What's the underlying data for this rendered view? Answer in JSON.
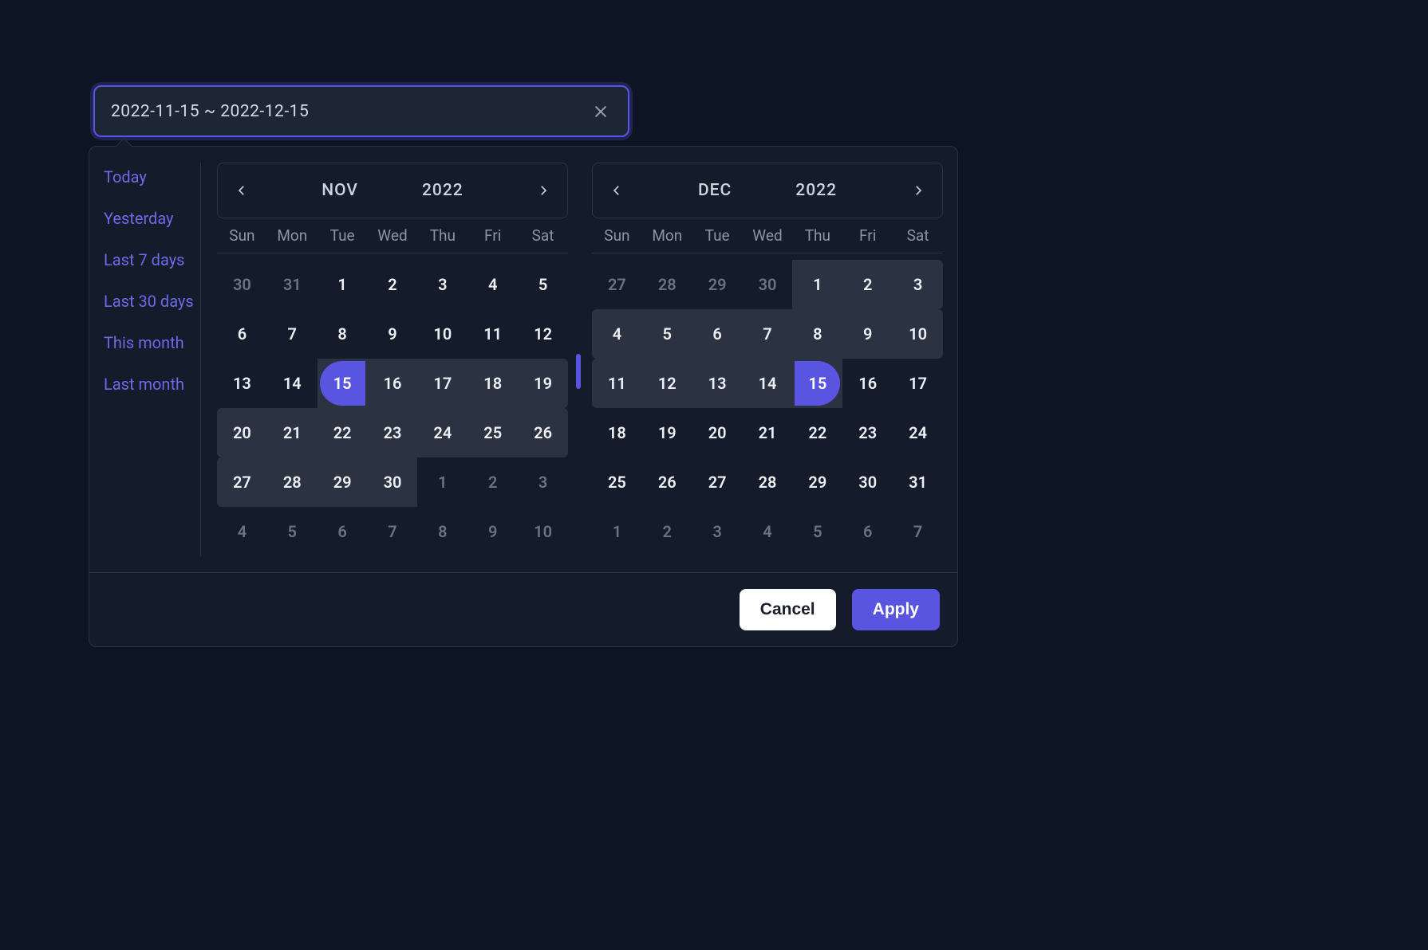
{
  "input": {
    "value": "2022-11-15 ~ 2022-12-15",
    "clear_icon": "close-icon"
  },
  "presets": [
    "Today",
    "Yesterday",
    "Last 7 days",
    "Last 30 days",
    "This month",
    "Last month"
  ],
  "weekdays": [
    "Sun",
    "Mon",
    "Tue",
    "Wed",
    "Thu",
    "Fri",
    "Sat"
  ],
  "months": [
    {
      "month_label": "NOV",
      "year_label": "2022",
      "cells": [
        {
          "n": 30,
          "out": true
        },
        {
          "n": 31,
          "out": true
        },
        {
          "n": 1
        },
        {
          "n": 2
        },
        {
          "n": 3
        },
        {
          "n": 4
        },
        {
          "n": 5
        },
        {
          "n": 6
        },
        {
          "n": 7
        },
        {
          "n": 8
        },
        {
          "n": 9
        },
        {
          "n": 10
        },
        {
          "n": 11
        },
        {
          "n": 12
        },
        {
          "n": 13
        },
        {
          "n": 14
        },
        {
          "n": 15,
          "ep": "start"
        },
        {
          "n": 16,
          "r": true
        },
        {
          "n": 17,
          "r": true
        },
        {
          "n": 18,
          "r": true
        },
        {
          "n": 19,
          "r": true,
          "rr": true
        },
        {
          "n": 20,
          "r": true,
          "rl": true
        },
        {
          "n": 21,
          "r": true
        },
        {
          "n": 22,
          "r": true
        },
        {
          "n": 23,
          "r": true
        },
        {
          "n": 24,
          "r": true
        },
        {
          "n": 25,
          "r": true
        },
        {
          "n": 26,
          "r": true,
          "rr": true
        },
        {
          "n": 27,
          "r": true,
          "rl": true
        },
        {
          "n": 28,
          "r": true
        },
        {
          "n": 29,
          "r": true
        },
        {
          "n": 30,
          "r": true
        },
        {
          "n": 1,
          "out": true
        },
        {
          "n": 2,
          "out": true
        },
        {
          "n": 3,
          "out": true
        },
        {
          "n": 4,
          "out": true
        },
        {
          "n": 5,
          "out": true
        },
        {
          "n": 6,
          "out": true
        },
        {
          "n": 7,
          "out": true
        },
        {
          "n": 8,
          "out": true
        },
        {
          "n": 9,
          "out": true
        },
        {
          "n": 10,
          "out": true
        }
      ]
    },
    {
      "month_label": "DEC",
      "year_label": "2022",
      "cells": [
        {
          "n": 27,
          "out": true
        },
        {
          "n": 28,
          "out": true
        },
        {
          "n": 29,
          "out": true
        },
        {
          "n": 30,
          "out": true
        },
        {
          "n": 1,
          "r": true
        },
        {
          "n": 2,
          "r": true
        },
        {
          "n": 3,
          "r": true,
          "rr": true
        },
        {
          "n": 4,
          "r": true,
          "rl": true
        },
        {
          "n": 5,
          "r": true
        },
        {
          "n": 6,
          "r": true
        },
        {
          "n": 7,
          "r": true
        },
        {
          "n": 8,
          "r": true
        },
        {
          "n": 9,
          "r": true
        },
        {
          "n": 10,
          "r": true,
          "rr": true
        },
        {
          "n": 11,
          "r": true,
          "rl": true
        },
        {
          "n": 12,
          "r": true
        },
        {
          "n": 13,
          "r": true
        },
        {
          "n": 14,
          "r": true
        },
        {
          "n": 15,
          "ep": "end"
        },
        {
          "n": 16
        },
        {
          "n": 17
        },
        {
          "n": 18
        },
        {
          "n": 19
        },
        {
          "n": 20
        },
        {
          "n": 21
        },
        {
          "n": 22
        },
        {
          "n": 23
        },
        {
          "n": 24
        },
        {
          "n": 25
        },
        {
          "n": 26
        },
        {
          "n": 27
        },
        {
          "n": 28
        },
        {
          "n": 29
        },
        {
          "n": 30
        },
        {
          "n": 31
        },
        {
          "n": 1,
          "out": true
        },
        {
          "n": 2,
          "out": true
        },
        {
          "n": 3,
          "out": true
        },
        {
          "n": 4,
          "out": true
        },
        {
          "n": 5,
          "out": true
        },
        {
          "n": 6,
          "out": true
        },
        {
          "n": 7,
          "out": true
        }
      ]
    }
  ],
  "footer": {
    "cancel_label": "Cancel",
    "apply_label": "Apply"
  }
}
